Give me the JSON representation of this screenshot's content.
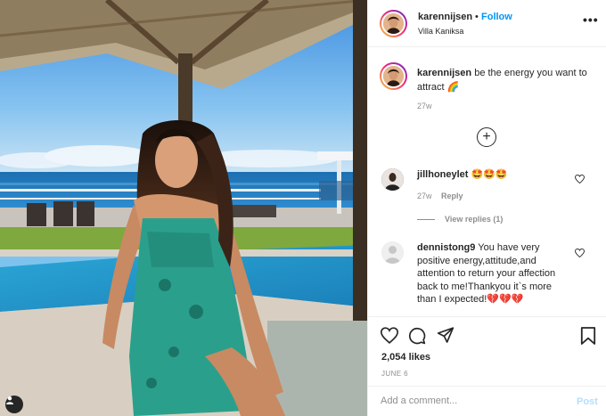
{
  "post": {
    "username": "karennijsen",
    "follow_label": "Follow",
    "separator": "•",
    "location": "Villa Kaniksa",
    "more_label": "•••"
  },
  "caption": {
    "username": "karennijsen",
    "text": " be the energy you want to attract 🌈",
    "time": "27w"
  },
  "load_more_label": "+",
  "comments": [
    {
      "username": "jillhoneylet",
      "text": " 🤩🤩🤩",
      "time": "27w",
      "reply_label": "Reply",
      "view_replies": "View replies (1)"
    },
    {
      "username": "dennistong9",
      "text": " You have very positive energy,attitude,and attention to return your affection back to me!Thankyou it`s more than I expected!💔💔💔"
    }
  ],
  "likes": "2,054 likes",
  "date": "JUNE 6",
  "add_comment": {
    "placeholder": "Add a comment...",
    "post_label": "Post"
  },
  "colors": {
    "link_blue": "#0095f6",
    "post_disabled": "#b2dffc",
    "muted": "#8e8e8e",
    "text": "#262626"
  }
}
